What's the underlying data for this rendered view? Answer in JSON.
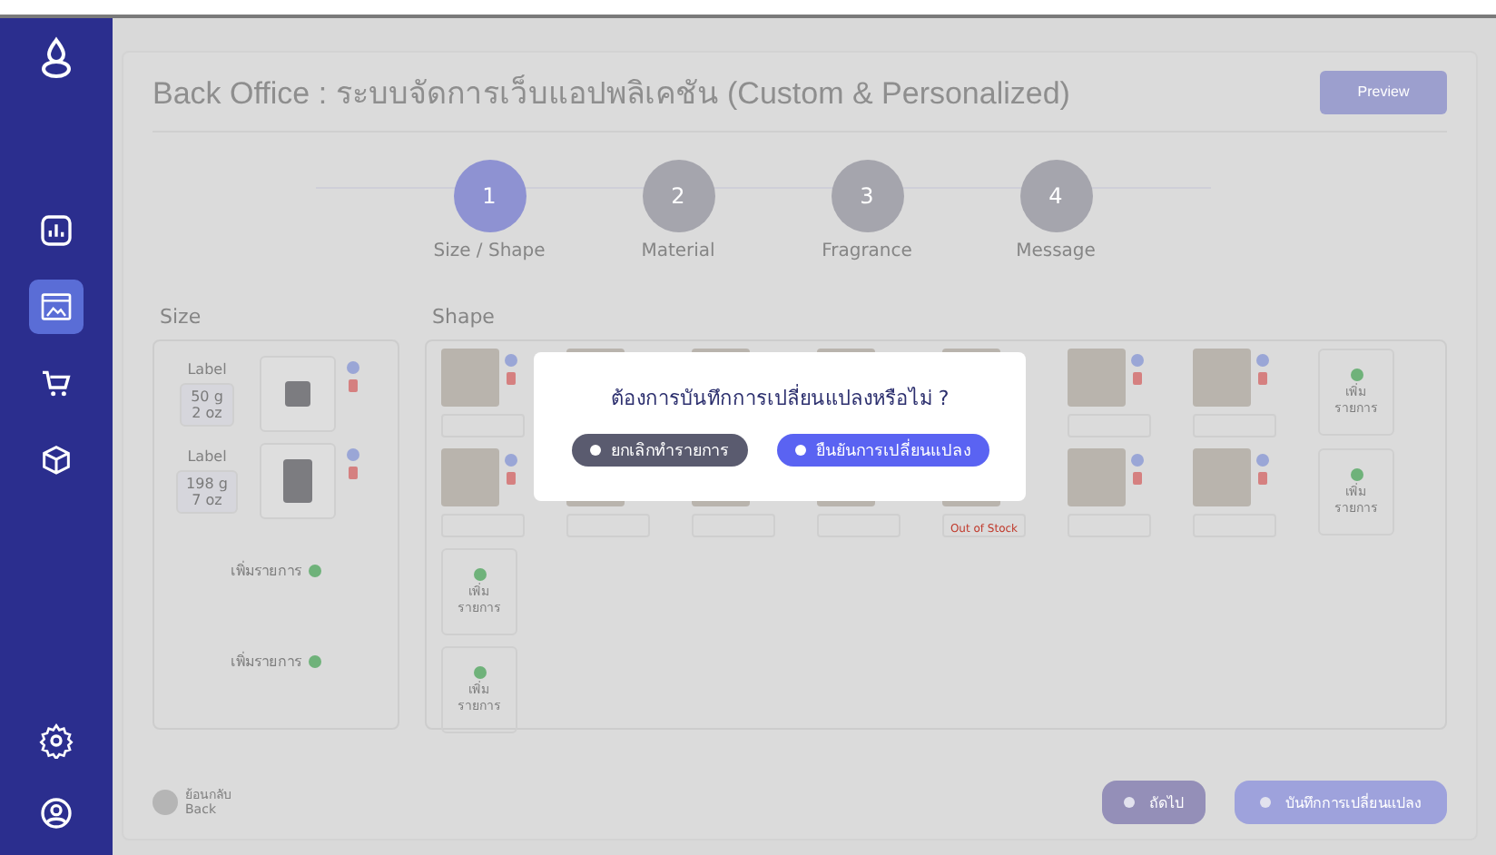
{
  "sidebar": {
    "items": [
      {
        "kind": "chart",
        "selected": false
      },
      {
        "kind": "web",
        "selected": true
      },
      {
        "kind": "cart",
        "selected": false
      },
      {
        "kind": "box",
        "selected": false
      }
    ],
    "bottom_items": [
      {
        "kind": "gear",
        "selected": false
      },
      {
        "kind": "user",
        "selected": false
      }
    ]
  },
  "header": {
    "title": "Back Office : ระบบจัดการเว็บแอปพลิเคชัน (Custom & Personalized)",
    "preview_button": "Preview"
  },
  "steps": [
    {
      "number": "1",
      "label": "Size / Shape",
      "selected": true
    },
    {
      "number": "2",
      "label": "Material",
      "selected": false
    },
    {
      "number": "3",
      "label": "Fragrance",
      "selected": false
    },
    {
      "number": "4",
      "label": "Message",
      "selected": false
    }
  ],
  "size": {
    "heading": "Size",
    "items": [
      {
        "label": "Label",
        "value": [
          "50 g",
          "2 oz"
        ],
        "kind": "short"
      },
      {
        "label": "Label",
        "value": [
          "198 g",
          "7 oz"
        ],
        "kind": "tall"
      }
    ],
    "add_rows": [
      "เพิ่มรายการ",
      "เพิ่มรายการ"
    ]
  },
  "shape": {
    "heading": "Shape",
    "rows": [
      [
        {
          "kind": "item"
        },
        {
          "kind": "item"
        },
        {
          "kind": "item"
        },
        {
          "kind": "item"
        },
        {
          "kind": "item"
        },
        {
          "kind": "item"
        },
        {
          "kind": "item"
        },
        {
          "kind": "add",
          "lines": [
            "เพิ่ม",
            "รายการ"
          ]
        }
      ],
      [
        {
          "kind": "item"
        },
        {
          "kind": "item"
        },
        {
          "kind": "item"
        },
        {
          "kind": "item"
        },
        {
          "kind": "item",
          "note": "Out of Stock"
        },
        {
          "kind": "item"
        },
        {
          "kind": "item"
        },
        {
          "kind": "add",
          "lines": [
            "เพิ่ม",
            "รายการ"
          ]
        }
      ],
      [
        {
          "kind": "add",
          "lines": [
            "เพิ่ม",
            "รายการ"
          ]
        }
      ],
      [
        {
          "kind": "add",
          "lines": [
            "เพิ่ม",
            "รายการ"
          ]
        }
      ]
    ]
  },
  "footer": {
    "back": [
      "ย้อนกลับ",
      "Back"
    ],
    "next_button": "ถัดไป",
    "save_button": "บันทึกการเปลี่ยนแปลง"
  },
  "dialog": {
    "message": "ต้องการบันทึกการเปลี่ยนแปลงหรือไม่ ?",
    "buttons": [
      {
        "kind": "cancel",
        "label": "ยกเลิกทำรายการ"
      },
      {
        "kind": "confirm",
        "label": "ยืนยันการเปลี่ยนแปลง"
      }
    ]
  }
}
